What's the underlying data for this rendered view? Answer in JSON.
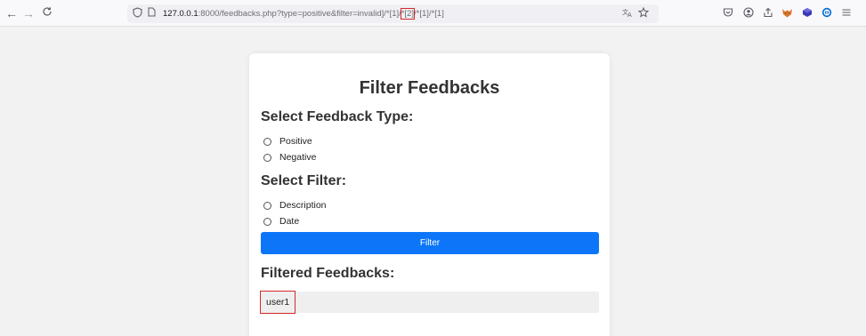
{
  "browser": {
    "back_icon": "←",
    "forward_icon": "→",
    "reload_icon": "C",
    "url_host": "127.0.0.1",
    "url_path_a": ":8000/feedbacks.php?type=positive&filter=invalid]/*[1]/",
    "url_highlight": "*[2]",
    "url_path_b": "/*[1]/*[1]"
  },
  "page": {
    "title": "Filter Feedbacks",
    "type_heading": "Select Feedback Type:",
    "type_options": [
      "Positive",
      "Negative"
    ],
    "filter_heading": "Select Filter:",
    "filter_options": [
      "Description",
      "Date"
    ],
    "filter_button": "Filter",
    "results_heading": "Filtered Feedbacks:",
    "results": [
      "user1"
    ]
  },
  "colors": {
    "button": "#0d76f8",
    "highlight_box": "#d62828"
  }
}
